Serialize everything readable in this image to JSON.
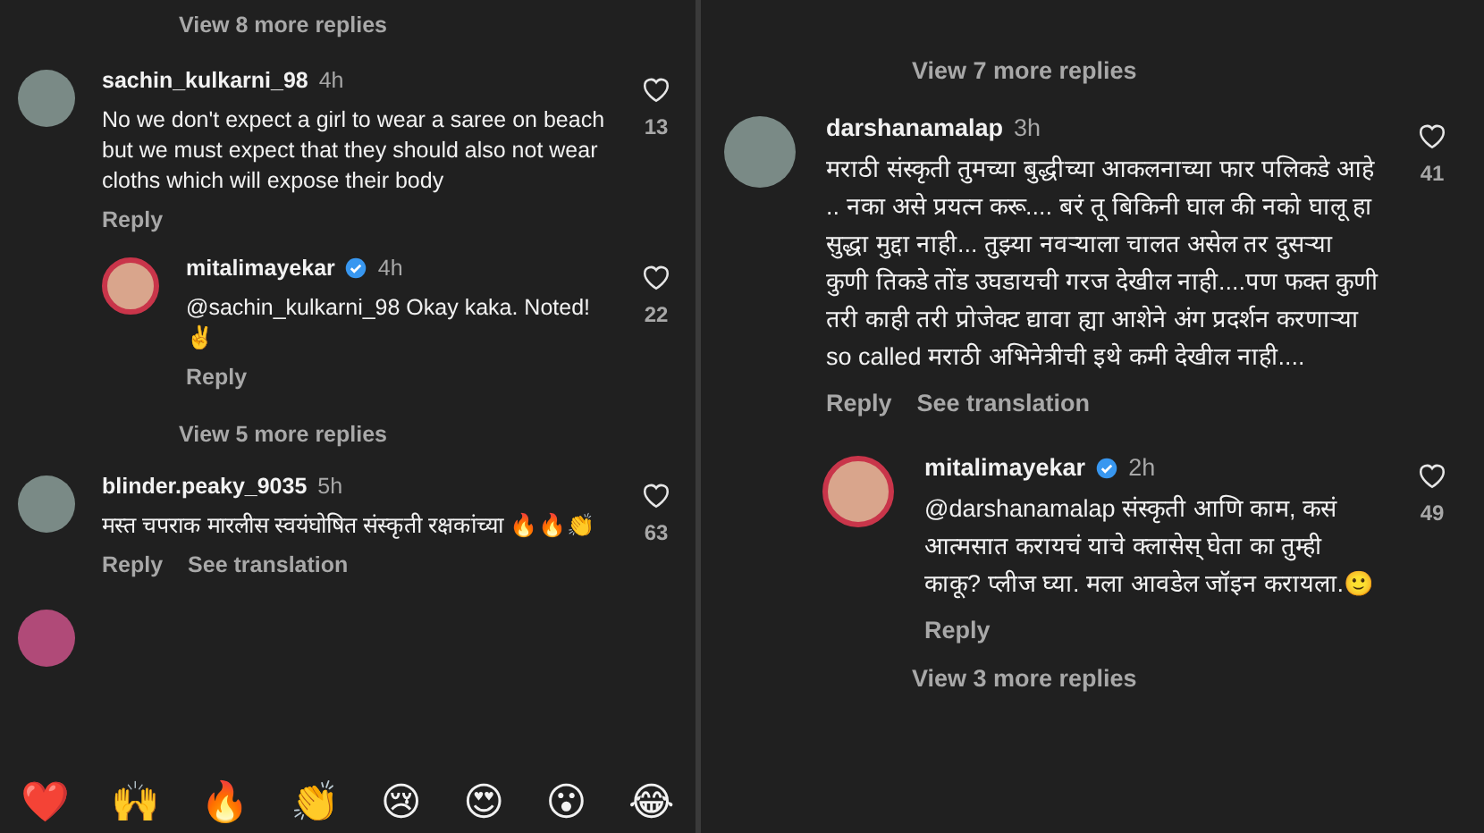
{
  "panels": [
    {
      "top_link": "View 8 more replies",
      "comments": [
        {
          "kind": "comment",
          "username": "sachin_kulkarni_98",
          "verified": false,
          "time": "4h",
          "text": "No we don't expect a girl to wear a saree on beach but we must expect that they should also not wear cloths which will expose their body",
          "likes": "13",
          "actions": [
            "Reply"
          ]
        },
        {
          "kind": "reply",
          "username": "mitalimayekar",
          "verified": true,
          "time": "4h",
          "text": "@sachin_kulkarni_98 Okay kaka. Noted!✌️",
          "likes": "22",
          "actions": [
            "Reply"
          ],
          "view_more": "View 5 more replies"
        },
        {
          "kind": "comment",
          "username": "blinder.peaky_9035",
          "verified": false,
          "time": "5h",
          "text": "मस्त चपराक मारलीस स्वयंघोषित संस्कृती रक्षकांच्या 🔥🔥👏",
          "likes": "63",
          "actions": [
            "Reply",
            "See translation"
          ]
        }
      ],
      "emoji_bar": [
        "❤️",
        "🙌",
        "🔥",
        "👏",
        "😢",
        "😍",
        "😮",
        "😂"
      ]
    },
    {
      "top_link": "View 7 more replies",
      "comments": [
        {
          "kind": "comment",
          "username": "darshanamalap",
          "verified": false,
          "time": "3h",
          "text": "मराठी संस्कृती तुमच्या बुद्धीच्या आकलनाच्या फार पलिकडे आहे .. नका असे प्रयत्न करू.... बरं तू बिकिनी घाल की नको घालू हा सुद्धा मुद्दा नाही... तुझ्या नवऱ्याला चालत असेल तर दुसऱ्या कुणी तिकडे तोंड उघडायची गरज देखील नाही....पण फक्त कुणी तरी काही तरी प्रोजेक्ट द्यावा ह्या आशेने अंग प्रदर्शन करणाऱ्या so called  मराठी अभिनेत्रीची इथे कमी देखील नाही....",
          "likes": "41",
          "actions": [
            "Reply",
            "See translation"
          ]
        },
        {
          "kind": "reply",
          "username": "mitalimayekar",
          "verified": true,
          "time": "2h",
          "text": "@darshanamalap संस्कृती आणि काम, कसं आत्मसात करायचं याचे क्लासेस् घेता का तुम्ही काकू? प्लीज घ्या. मला आवडेल जॉइन करायला.🙂",
          "likes": "49",
          "actions": [
            "Reply"
          ],
          "view_more": "View 3 more replies"
        }
      ]
    }
  ]
}
